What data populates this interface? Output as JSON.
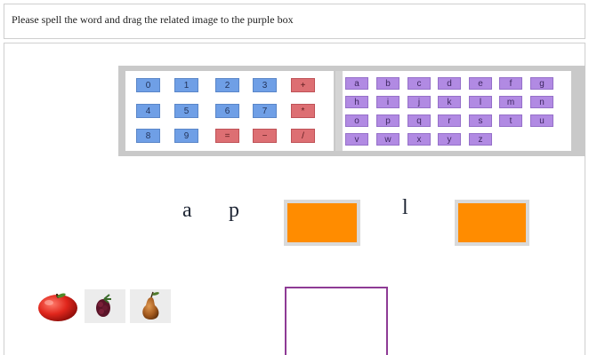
{
  "instruction": {
    "text": "Please spell the word and drag the related image to the purple box"
  },
  "numpad": {
    "rows": [
      [
        "0",
        "1",
        "2",
        "3",
        "+"
      ],
      [
        "4",
        "5",
        "6",
        "7",
        "*"
      ],
      [
        "8",
        "9",
        "=",
        "−",
        "/"
      ]
    ]
  },
  "alphapad": {
    "rows": [
      [
        "a",
        "b",
        "c",
        "d",
        "e",
        "f",
        "g"
      ],
      [
        "h",
        "i",
        "j",
        "k",
        "l",
        "m",
        "n"
      ],
      [
        "o",
        "p",
        "q",
        "r",
        "s",
        "t",
        "u"
      ],
      [
        "v",
        "w",
        "x",
        "y",
        "z"
      ]
    ]
  },
  "word": {
    "letters": [
      "a",
      "p",
      "l"
    ],
    "blanks": 2
  },
  "images": {
    "items": [
      "apple",
      "blackberry",
      "pear"
    ]
  },
  "colors": {
    "number_key": "#6f9fe6",
    "operator_key": "#dd6f73",
    "letter_key": "#b18ae3",
    "letter_slot": "#ff8c00",
    "drop_box_border": "#8e3b95",
    "keypad_frame": "#c9c9c9"
  }
}
